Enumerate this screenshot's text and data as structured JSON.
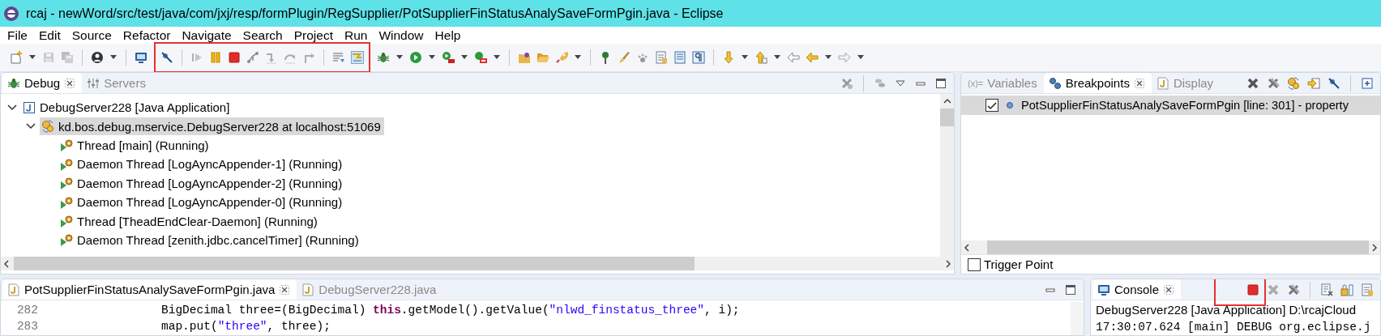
{
  "window": {
    "title": "rcaj - newWord/src/test/java/com/jxj/resp/formPlugin/RegSupplier/PotSupplierFinStatusAnalySaveFormPgin.java - Eclipse"
  },
  "menu": [
    "File",
    "Edit",
    "Source",
    "Refactor",
    "Navigate",
    "Search",
    "Project",
    "Run",
    "Window",
    "Help"
  ],
  "toolbar": {
    "groups": [
      {
        "highlighted": false
      },
      {
        "highlighted": true
      },
      {
        "highlighted": false
      }
    ]
  },
  "debug_view": {
    "tabs": [
      {
        "label": "Debug",
        "kind": "debug",
        "selected": true
      },
      {
        "label": "Servers",
        "kind": "servers",
        "selected": false
      }
    ],
    "tree": [
      {
        "label": "DebugServer228 [Java Application]",
        "kind": "launch",
        "expanded": true,
        "selected": false,
        "children": [
          {
            "label": "kd.bos.debug.mservice.DebugServer228 at localhost:51069",
            "kind": "target",
            "expanded": true,
            "selected": true,
            "children": [
              {
                "label": "Thread [main] (Running)",
                "kind": "thread",
                "selected": false
              },
              {
                "label": "Daemon Thread [LogAyncAppender-1] (Running)",
                "kind": "thread",
                "selected": false
              },
              {
                "label": "Daemon Thread [LogAyncAppender-2] (Running)",
                "kind": "thread",
                "selected": false
              },
              {
                "label": "Daemon Thread [LogAyncAppender-0] (Running)",
                "kind": "thread",
                "selected": false
              },
              {
                "label": "Thread [TheadEndClear-Daemon] (Running)",
                "kind": "thread",
                "selected": false
              },
              {
                "label": "Daemon Thread [zenith.jdbc.cancelTimer] (Running)",
                "kind": "thread",
                "selected": false
              }
            ]
          }
        ]
      }
    ]
  },
  "breakpoints_view": {
    "tabs": [
      {
        "label": "Variables",
        "kind": "variables",
        "icon_text": "(x)=",
        "selected": false
      },
      {
        "label": "Breakpoints",
        "kind": "breakpoints",
        "selected": true
      },
      {
        "label": "Display",
        "kind": "display",
        "selected": false
      }
    ],
    "breakpoints": [
      {
        "label": "PotSupplierFinStatusAnalySaveFormPgin [line: 301] - property",
        "checked": true,
        "selected": true
      }
    ],
    "trigger_point": {
      "label": "Trigger Point",
      "checked": false
    }
  },
  "editor": {
    "tabs": [
      {
        "label": "PotSupplierFinStatusAnalySaveFormPgin.java",
        "kind": "java",
        "selected": true
      },
      {
        "label": "DebugServer228.java",
        "kind": "java",
        "selected": false
      }
    ],
    "lines": [
      {
        "number": "282",
        "tokens": [
          {
            "kind": "plain",
            "text": "BigDecimal three=(BigDecimal) "
          },
          {
            "kind": "keyword",
            "text": "this"
          },
          {
            "kind": "plain",
            "text": ".getModel().getValue("
          },
          {
            "kind": "string",
            "text": "\"nlwd_finstatus_three\""
          },
          {
            "kind": "plain",
            "text": ", i);"
          }
        ]
      },
      {
        "number": "283",
        "tokens": [
          {
            "kind": "plain",
            "text": "map.put("
          },
          {
            "kind": "string",
            "text": "\"three\""
          },
          {
            "kind": "plain",
            "text": ", three);"
          }
        ]
      }
    ]
  },
  "console_view": {
    "tabs": [
      {
        "label": "Console",
        "kind": "console",
        "selected": true
      }
    ],
    "stop_highlighted": true,
    "lines": [
      {
        "kind": "process",
        "text": "DebugServer228 [Java Application] D:\\rcajCloud"
      },
      {
        "kind": "log",
        "text": "17:30:07.624 [main] DEBUG org.eclipse.j"
      }
    ]
  }
}
